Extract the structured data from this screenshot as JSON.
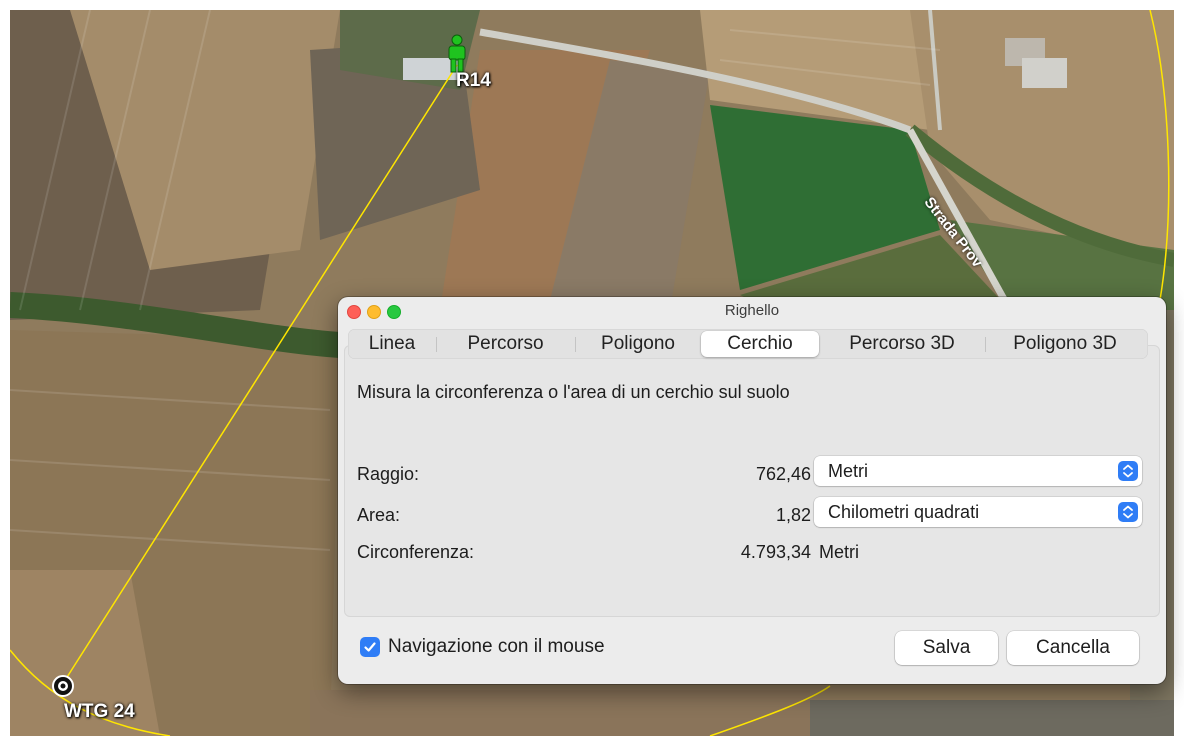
{
  "map": {
    "markers": [
      {
        "label": "R14",
        "icon": "person-marker-icon"
      },
      {
        "label": "WTG 24",
        "icon": "target-marker-icon"
      }
    ],
    "road_label": "Strada Prov"
  },
  "window": {
    "title": "Righello"
  },
  "tabs": [
    {
      "label": "Linea",
      "active": false
    },
    {
      "label": "Percorso",
      "active": false
    },
    {
      "label": "Poligono",
      "active": false
    },
    {
      "label": "Cerchio",
      "active": true
    },
    {
      "label": "Percorso 3D",
      "active": false
    },
    {
      "label": "Poligono 3D",
      "active": false
    }
  ],
  "panel": {
    "description": "Misura la circonferenza o l'area di un cerchio sul suolo",
    "rows": {
      "radius": {
        "label": "Raggio:",
        "value": "762,46",
        "unit": "Metri"
      },
      "area": {
        "label": "Area:",
        "value": "1,82",
        "unit": "Chilometri quadrati"
      },
      "circumference": {
        "label": "Circonferenza:",
        "value": "4.793,34",
        "unit": "Metri"
      }
    }
  },
  "footer": {
    "mouse_nav_label": "Navigazione con il mouse",
    "mouse_nav_checked": true,
    "save_label": "Salva",
    "cancel_label": "Cancella"
  },
  "colors": {
    "accent": "#2f7df6",
    "measure_line": "#ffe600",
    "marker_green": "#1fc31f"
  }
}
